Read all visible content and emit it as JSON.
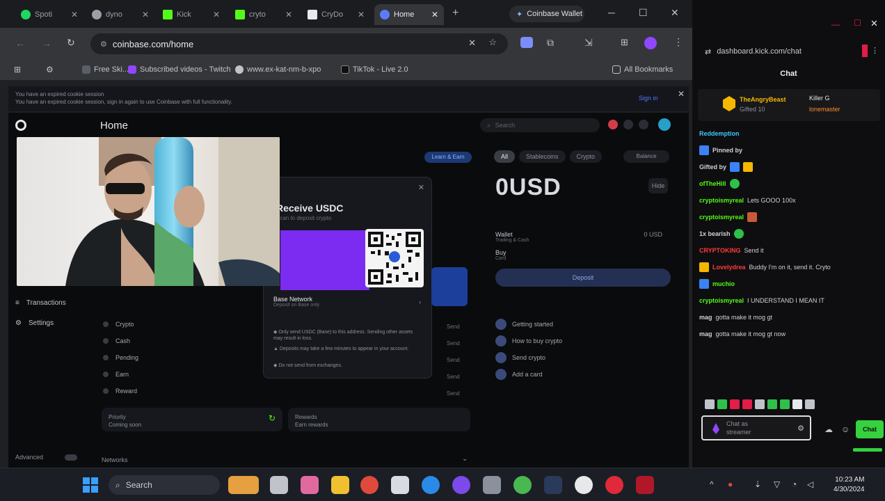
{
  "browser": {
    "tabs": [
      {
        "label": "Spoti",
        "color": "#1ed760",
        "active": false
      },
      {
        "label": "dyno",
        "color": "#9aa0a8",
        "active": false
      },
      {
        "label": "Kick",
        "color": "#53fc18",
        "active": false
      },
      {
        "label": "cryto",
        "color": "#53fc18",
        "active": false
      },
      {
        "label": "CryDo",
        "color": "#e8eaed",
        "active": false
      },
      {
        "label": "Home",
        "color": "#5b7cfa",
        "active": true
      }
    ],
    "new_tab": "+",
    "wallet_tab": "Coinbase Wallet",
    "window_controls": {
      "minimize": "─",
      "maximize": "☐",
      "close": "✕"
    },
    "url": "coinbase.com/home",
    "bookmarks": [
      {
        "label": "Free Ski...",
        "color": "#5a5e66"
      },
      {
        "label": "Subscribed videos - Twitch",
        "color": "#9146ff"
      },
      {
        "label": "www.ex-kat-nm-b-xpo",
        "color": "#c0c4ca"
      },
      {
        "label": "TikTok - Live 2.0",
        "color": "#111111"
      }
    ],
    "all_bookmarks": "All Bookmarks",
    "banner_text": [
      "You have an expired cookie session",
      "You have an expired cookie session, sign in again to use Coinbase with full functionality."
    ],
    "banner_link": "Sign in"
  },
  "coinbase": {
    "title": "Home",
    "search_placeholder": "Search",
    "left_nav": [
      "Transactions",
      "Settings"
    ],
    "assets": [
      "Crypto",
      "Cash",
      "Pending",
      "Earn",
      "Reward"
    ],
    "asset_action": "Send",
    "promo_badge": "Learn & Earn",
    "balance_tabs": [
      "All",
      "Stablecoins",
      "Crypto"
    ],
    "balance_select": "Balance",
    "balance": "0USD",
    "eye_button": "Hide",
    "accounts": [
      {
        "name": "Wallet",
        "sub": "Trading & Cash",
        "right": "0 USD"
      },
      {
        "name": "Buy",
        "sub": "Card",
        "right": ""
      }
    ],
    "fund_button": "Deposit",
    "help_items": [
      "Getting started",
      "How to buy crypto",
      "Send crypto",
      "Add a card"
    ],
    "receive_modal": {
      "title": "Receive USDC",
      "subtitle": "Scan to deposit crypto",
      "network": "Base Network",
      "network_sub": "Deposit on Base only",
      "notices": [
        "Only send USDC (Base) to this address. Sending other assets may result in loss.",
        "Deposits may take a few minutes to appear in your account.",
        "Do not send from exchanges."
      ]
    },
    "bottom_cards": [
      {
        "title": "Priority",
        "sub": "Coming soon"
      },
      {
        "title": "Rewards",
        "sub": "Earn rewards"
      }
    ],
    "sidebar_toggle": "Advanced",
    "network_label": "Networks"
  },
  "chat": {
    "url": "dashboard.kick.com/chat",
    "title": "Chat",
    "pinned": {
      "user": "TheAngryBeast",
      "sub": "Gifted 10",
      "right1": "Killer G",
      "right2": "lonemaster"
    },
    "messages": [
      {
        "user": "Reddemption",
        "text": "",
        "color": "#3cc8ff"
      },
      {
        "user": "Pinned by",
        "text": "",
        "color": "#d0d2d6"
      },
      {
        "user": "Gifted by",
        "text": "",
        "color": "#d0d2d6"
      },
      {
        "user": "ofTheHill",
        "text": "",
        "color": "#53fc18"
      },
      {
        "user": "cryptoismyreal",
        "text": "Lets GOOO 100x",
        "color": "#53fc18"
      },
      {
        "user": "cryptoismyreal",
        "text": "",
        "color": "#53fc18"
      },
      {
        "user": "1x bearish",
        "text": "",
        "color": "#d0d2d6"
      },
      {
        "user": "CRYPTOKING",
        "text": "Send it",
        "color": "#ff3b3b"
      },
      {
        "user": "Lovelydrea",
        "text": "Buddy I'm on it, send it. Cryto",
        "color": "#ff3b3b"
      },
      {
        "user": "muchio",
        "text": "",
        "color": "#53fc18"
      },
      {
        "user": "cryptoismyreal",
        "text": "I UNDERSTAND I MEAN IT",
        "color": "#53fc18"
      },
      {
        "user": "mag",
        "text": "gotta make it mog gt",
        "color": "#d0d2d6"
      },
      {
        "user": "mag",
        "text": "gotta make it mog gt now",
        "color": "#d0d2d6"
      }
    ],
    "input_placeholder": "Chat as",
    "input_sub": "streamer",
    "send_label": "Chat"
  },
  "taskbar": {
    "search": "Search",
    "time": "10:23 AM",
    "date": "4/30/2024"
  },
  "accent": "#7b2cf0"
}
